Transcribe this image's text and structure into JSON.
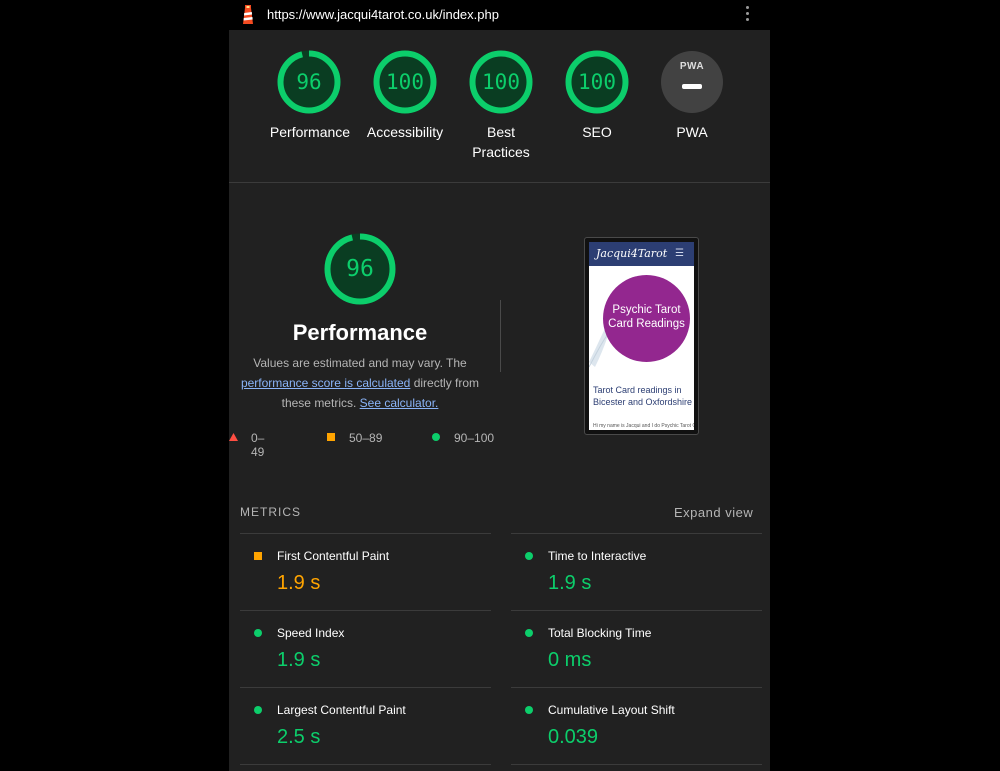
{
  "browser": {
    "url": "https://www.jacqui4tarot.co.uk/index.php"
  },
  "colors": {
    "pass": "#0cce6b",
    "average": "#ffa400",
    "fail": "#ff4e42",
    "link": "#8ab4f8"
  },
  "categories": [
    {
      "score": "96",
      "label": "Performance",
      "progress": 0.96
    },
    {
      "score": "100",
      "label": "Accessibility",
      "progress": 1.0
    },
    {
      "score": "100",
      "label": "Best",
      "label2": "Practices",
      "progress": 1.0
    },
    {
      "score": "100",
      "label": "SEO",
      "progress": 1.0
    },
    {
      "badge": "PWA",
      "label": "PWA"
    }
  ],
  "performance": {
    "score": "96",
    "progress": 0.96,
    "title": "Performance",
    "desc_start": "Values are estimated and may vary. The ",
    "link1": "performance score is calculated",
    "desc_mid": " directly from these metrics. ",
    "link2": "See calculator."
  },
  "legend": {
    "fail": "0–49",
    "average": "50–89",
    "pass": "90–100"
  },
  "screenshot": {
    "brand": "Jacqui4Tarot",
    "circle_text": "Psychic Tarot Card Readings",
    "heading": "Tarot Card readings in Bicester and Oxfordshire",
    "body": "Hi my name is Jacqui and I do Psychic Tarot Card Readings"
  },
  "metrics": {
    "heading": "METRICS",
    "expand": "Expand view",
    "items": [
      {
        "name": "First Contentful Paint",
        "value": "1.9 s",
        "status": "average"
      },
      {
        "name": "Time to Interactive",
        "value": "1.9 s",
        "status": "pass"
      },
      {
        "name": "Speed Index",
        "value": "1.9 s",
        "status": "pass"
      },
      {
        "name": "Total Blocking Time",
        "value": "0 ms",
        "status": "pass"
      },
      {
        "name": "Largest Contentful Paint",
        "value": "2.5 s",
        "status": "pass"
      },
      {
        "name": "Cumulative Layout Shift",
        "value": "0.039",
        "status": "pass"
      }
    ]
  }
}
